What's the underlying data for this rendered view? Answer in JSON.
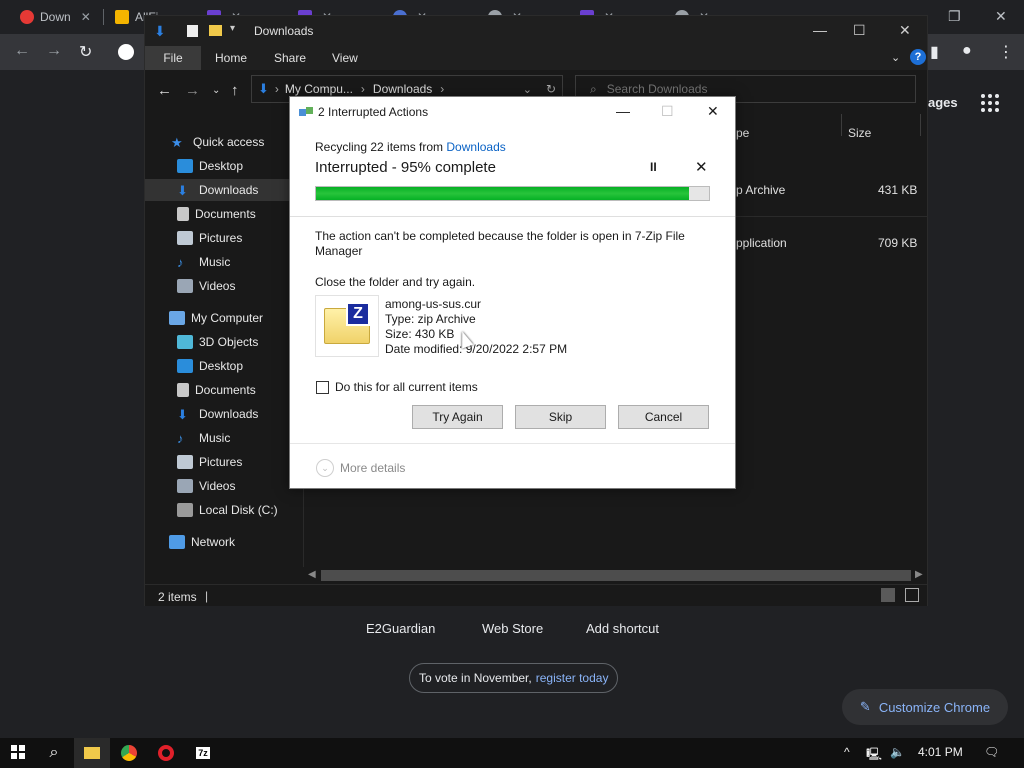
{
  "chrome": {
    "tabs": [
      "Down",
      "AllFi",
      "",
      "",
      "",
      "",
      "",
      "",
      ""
    ],
    "images_label": "ages",
    "shortcuts": [
      "E2Guardian",
      "Web Store",
      "Add shortcut"
    ],
    "vote_text": "To vote in November,",
    "vote_link": "register today",
    "customize_label": "Customize Chrome"
  },
  "explorer": {
    "title": "Downloads",
    "ribbon_tabs": [
      "File",
      "Home",
      "Share",
      "View"
    ],
    "breadcrumb": [
      "My Compu...",
      "Downloads"
    ],
    "search_placeholder": "Search Downloads",
    "nav_items": [
      {
        "label": "Quick access",
        "color": "#3b8eea"
      },
      {
        "label": "Desktop",
        "color": "#2a8ddb"
      },
      {
        "label": "Downloads",
        "color": "#2b7fe0"
      },
      {
        "label": "Documents",
        "color": "#c8c8c8"
      },
      {
        "label": "Pictures",
        "color": "#bfc9d4"
      },
      {
        "label": "Music",
        "color": "#3a8bdc"
      },
      {
        "label": "Videos",
        "color": "#9aa6b5"
      },
      {
        "label": "My Computer",
        "color": "#6aa7e6"
      },
      {
        "label": "3D Objects",
        "color": "#4fb8d8"
      },
      {
        "label": "Desktop",
        "color": "#2a8ddb"
      },
      {
        "label": "Documents",
        "color": "#c8c8c8"
      },
      {
        "label": "Downloads",
        "color": "#2b7fe0"
      },
      {
        "label": "Music",
        "color": "#3a8bdc"
      },
      {
        "label": "Pictures",
        "color": "#bfc9d4"
      },
      {
        "label": "Videos",
        "color": "#9aa6b5"
      },
      {
        "label": "Local Disk (C:)",
        "color": "#9a9a9a"
      },
      {
        "label": "Network",
        "color": "#4f9be6"
      }
    ],
    "columns": [
      "pe",
      "Size"
    ],
    "rows": [
      {
        "type": "p Archive",
        "size": "431 KB"
      },
      {
        "type": "pplication",
        "size": "709 KB"
      }
    ],
    "status_count": "2 items"
  },
  "dialog": {
    "title": "2 Interrupted Actions",
    "recycling_text": "Recycling 22 items from",
    "recycling_link": "Downloads",
    "progress_title": "Interrupted - 95% complete",
    "progress": 0.95,
    "pause_glyph": "II",
    "cancel_glyph": "✕",
    "message": "The action can't be completed because the folder is open in 7-Zip File Manager",
    "message2": "Close the folder and try again.",
    "file": {
      "name": "among-us-sus.cur",
      "type": "Type: zip Archive",
      "size": "Size: 430 KB",
      "date": "Date modified: 9/20/2022 2:57 PM"
    },
    "zip_badge": "Z",
    "checkbox_label": "Do this for all current items",
    "buttons": {
      "try_again": "Try Again",
      "skip": "Skip",
      "cancel": "Cancel"
    },
    "more_details": "More details"
  },
  "taskbar": {
    "clock": "4:01 PM",
    "pinned": [
      "windows-icon",
      "search-icon",
      "file-explorer-icon",
      "chrome-icon",
      "opera-icon",
      "7zip-icon"
    ],
    "z7_label": "7z"
  }
}
